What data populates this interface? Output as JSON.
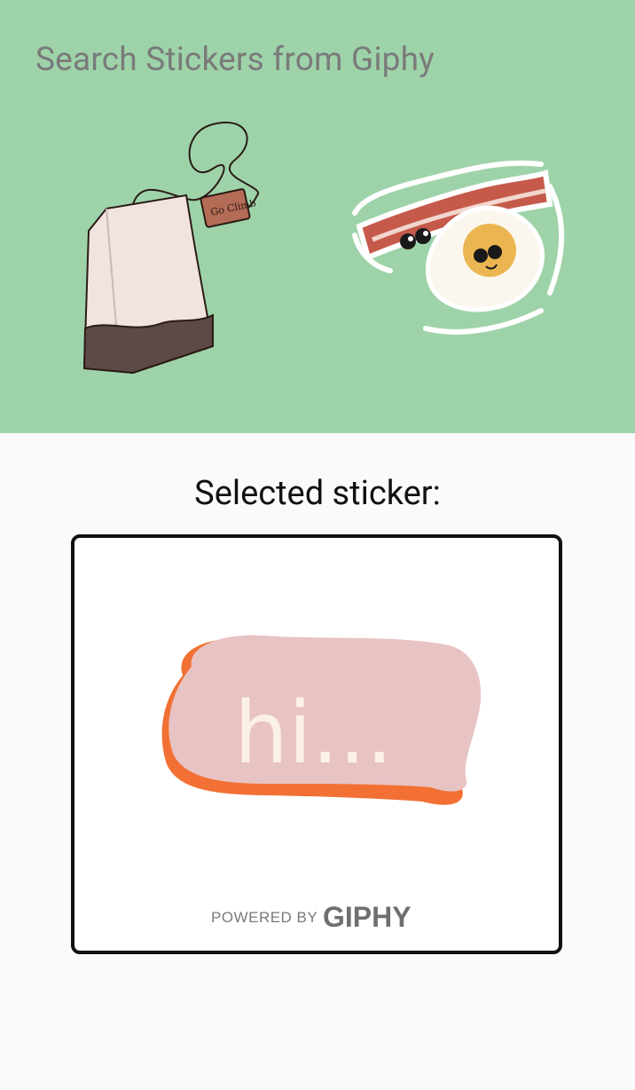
{
  "search": {
    "placeholder": "Search Stickers from Giphy"
  },
  "results": [
    {
      "name": "tea-bag-sticker",
      "tag_text": "Go Climb"
    },
    {
      "name": "bacon-egg-sticker"
    }
  ],
  "selected": {
    "label": "Selected sticker:",
    "sticker_text": "hi...",
    "powered_prefix": "POWERED BY",
    "powered_brand": "GIPHY"
  },
  "colors": {
    "header_bg": "#9ed3a9",
    "page_bg": "#fafafa",
    "bubble_pink": "#e8c3c3",
    "bubble_shadow": "#f27034"
  }
}
